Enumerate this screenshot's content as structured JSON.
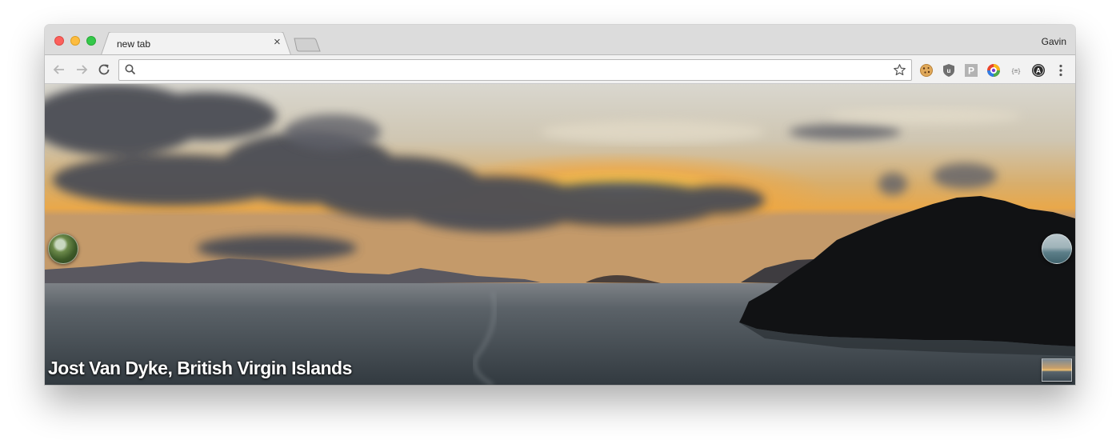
{
  "window": {
    "tab": {
      "title": "new tab",
      "close_glyph": "×"
    },
    "profile": {
      "name": "Gavin"
    }
  },
  "toolbar": {
    "back_icon": "back-arrow-icon",
    "forward_icon": "forward-arrow-icon",
    "reload_icon": "reload-icon",
    "omnibox": {
      "value": "",
      "placeholder": ""
    },
    "extensions": [
      {
        "name": "cookie-extension-icon"
      },
      {
        "name": "ublock-extension-icon"
      },
      {
        "name": "p-extension-icon",
        "label": "P"
      },
      {
        "name": "color-picker-extension-icon"
      },
      {
        "name": "json-viewer-extension-icon",
        "label": "{≡}"
      },
      {
        "name": "a-extension-icon",
        "label": "A"
      },
      {
        "name": "menu-icon"
      }
    ]
  },
  "content": {
    "location_caption": "Jost Van Dyke, British Virgin Islands"
  },
  "colors": {
    "sky_top": "#dcdcd4",
    "sunset_glow": "#f6b23a",
    "water": "#3d464d",
    "island": "#0f1012"
  }
}
